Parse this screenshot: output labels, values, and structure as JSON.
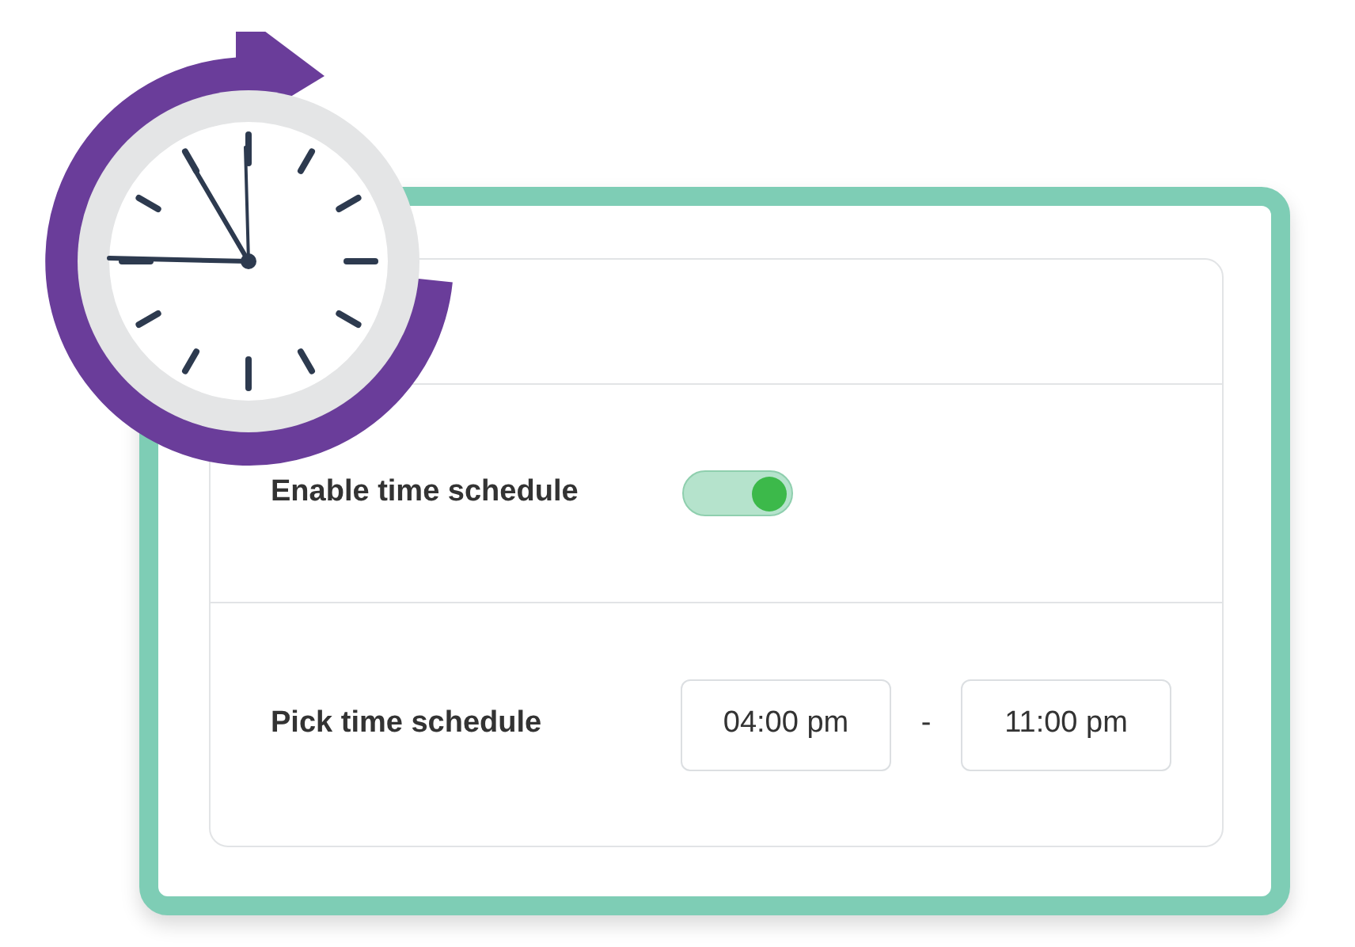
{
  "schedule": {
    "enable_label": "Enable time schedule",
    "enabled": true,
    "pick_label": "Pick time schedule",
    "start_time": "04:00 pm",
    "separator": "-",
    "end_time": "11:00 pm"
  }
}
